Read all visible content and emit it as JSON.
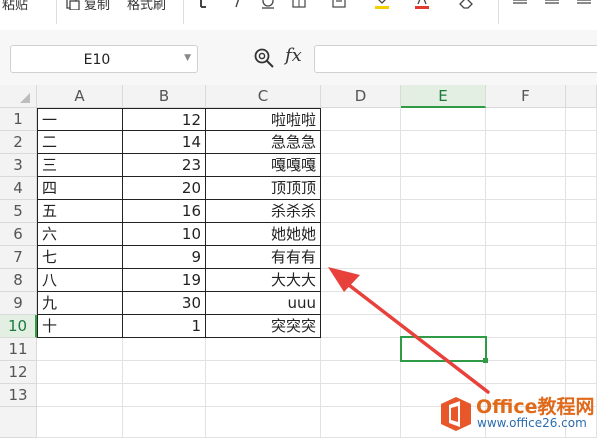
{
  "ribbon": {
    "paste_label": "粘贴",
    "copy_label": "复制",
    "format_painter_label": "格式刷"
  },
  "formula_bar": {
    "name_box": "E10",
    "fx_label": "fx",
    "formula": ""
  },
  "sheet": {
    "columns": [
      "A",
      "B",
      "C",
      "D",
      "E",
      "F"
    ],
    "rows": [
      "1",
      "2",
      "3",
      "4",
      "5",
      "6",
      "7",
      "8",
      "9",
      "10",
      "11",
      "12",
      "13"
    ],
    "data": [
      {
        "a": "一",
        "b": "12",
        "c": "啦啦啦"
      },
      {
        "a": "二",
        "b": "14",
        "c": "急急急"
      },
      {
        "a": "三",
        "b": "23",
        "c": "嘎嘎嘎"
      },
      {
        "a": "四",
        "b": "20",
        "c": "顶顶顶"
      },
      {
        "a": "五",
        "b": "16",
        "c": "杀杀杀"
      },
      {
        "a": "六",
        "b": "10",
        "c": "她她她"
      },
      {
        "a": "七",
        "b": "9",
        "c": "有有有"
      },
      {
        "a": "八",
        "b": "19",
        "c": "大大大"
      },
      {
        "a": "九",
        "b": "30",
        "c": "uuu"
      },
      {
        "a": "十",
        "b": "1",
        "c": "突突突"
      }
    ],
    "selected_cell": "E10"
  },
  "watermark": {
    "title": "Office教程网",
    "url": "www.office26.com"
  },
  "colors": {
    "selection": "#2f9b45",
    "arrow": "#e8413c",
    "watermark_orange": "#e06a1b"
  }
}
